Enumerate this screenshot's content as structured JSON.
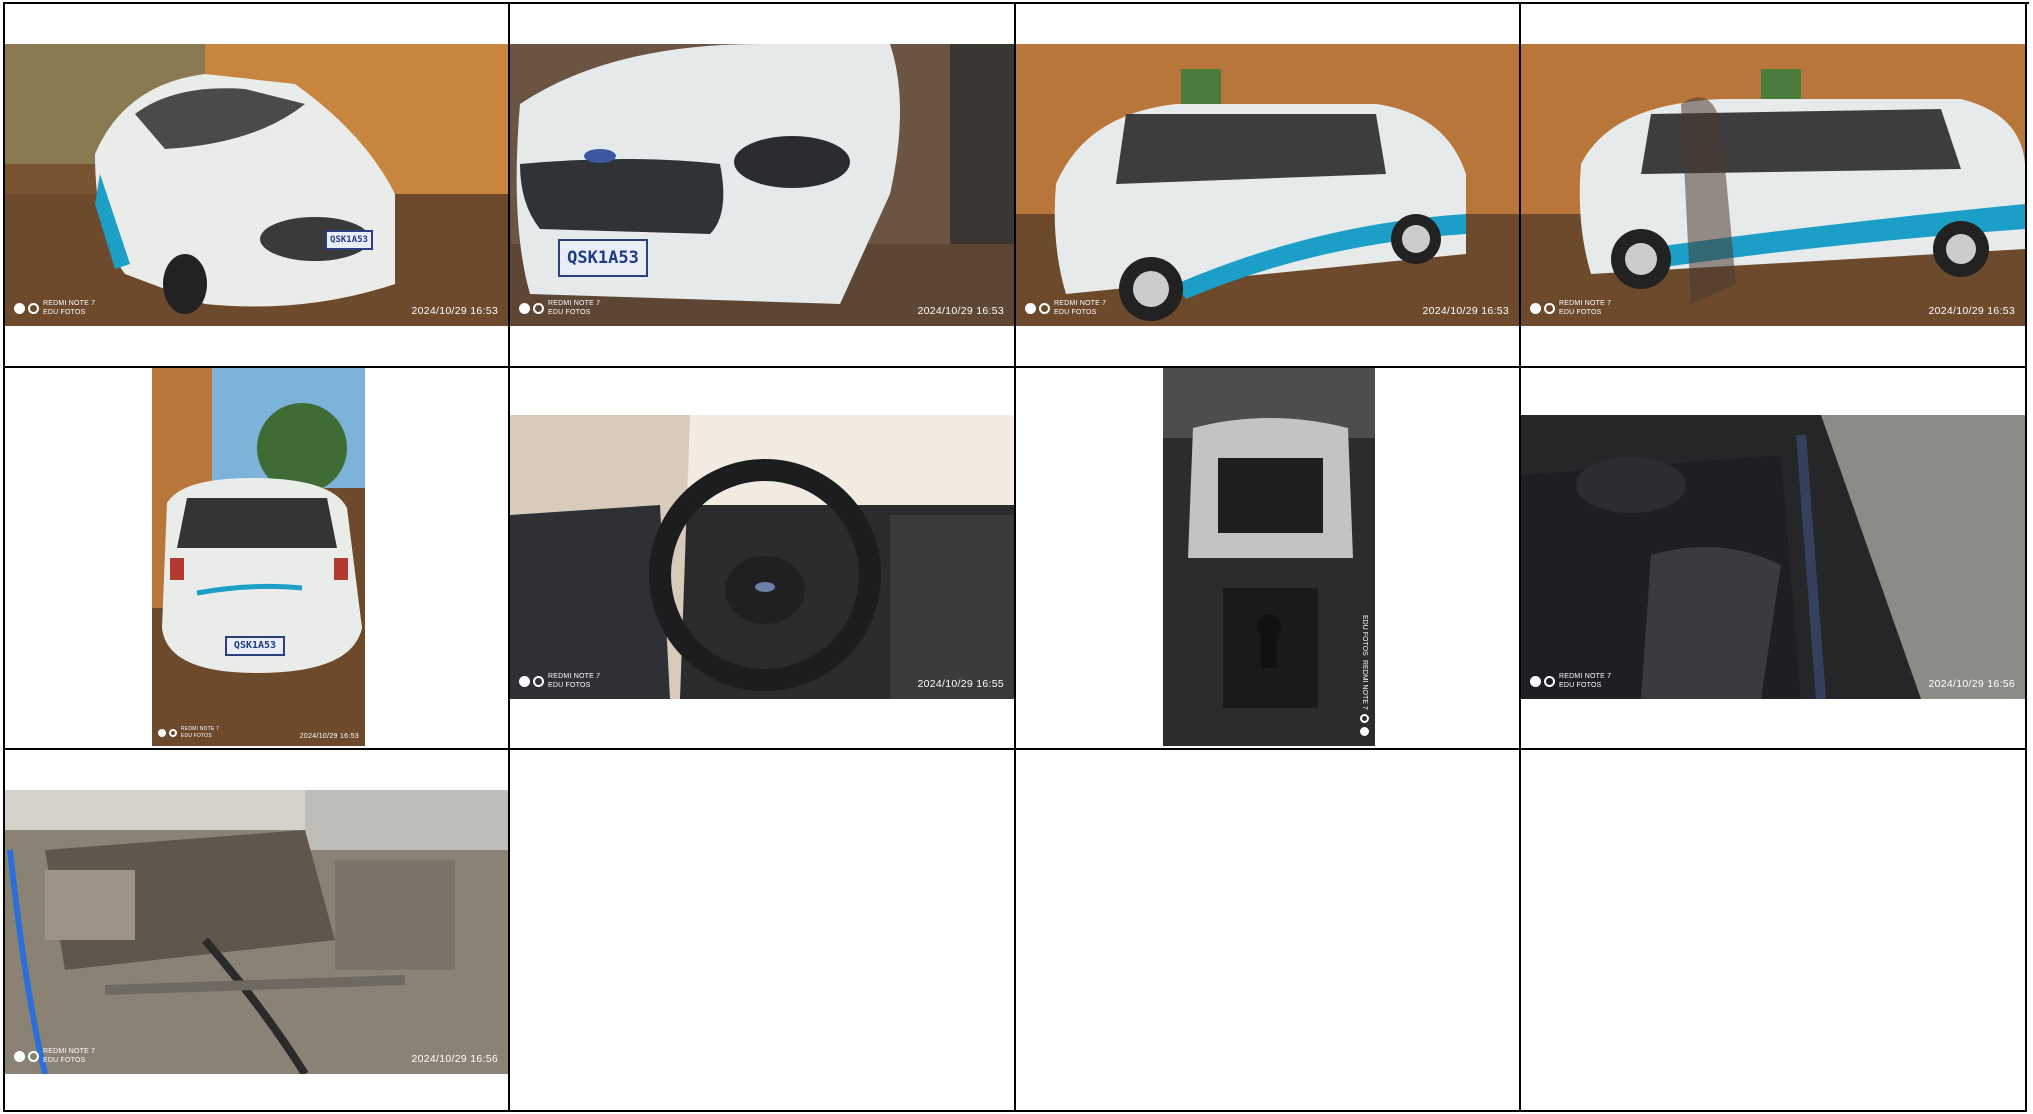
{
  "watermark": {
    "device": "REDMI NOTE 7",
    "author": "EDU FOTOS"
  },
  "photos": [
    {
      "subject": "Front-right view of white hatchback parked beside brick wall",
      "timestamp": "2024/10/29  16:53",
      "plate": "QSK1A53"
    },
    {
      "subject": "Close front view of white hatchback grille and license plate",
      "timestamp": "2024/10/29  16:53",
      "plate": "QSK1A53"
    },
    {
      "subject": "Right side view of white hatchback with municipal decals",
      "timestamp": "2024/10/29  16:53"
    },
    {
      "subject": "Right side view of white hatchback with photographer shadow",
      "timestamp": "2024/10/29  16:53"
    },
    {
      "subject": "Rear view of white hatchback",
      "timestamp": "2024/10/29  16:53",
      "plate": "QSK1A53"
    },
    {
      "subject": "Interior view of steering wheel and dashboard",
      "timestamp": "2024/10/29  16:55"
    },
    {
      "subject": "Center console and gear shifter",
      "timestamp": ""
    },
    {
      "subject": "Rear seat interior",
      "timestamp": "2024/10/29  16:56"
    },
    {
      "subject": "Engine bay with exposed components",
      "timestamp": "2024/10/29  16:56"
    }
  ],
  "colors": {
    "grid_line": "#000000",
    "car_white": "#e9ece9",
    "decal_blue": "#1b9fc7",
    "brick": "#b9763a",
    "dirt": "#6e4a2d"
  }
}
